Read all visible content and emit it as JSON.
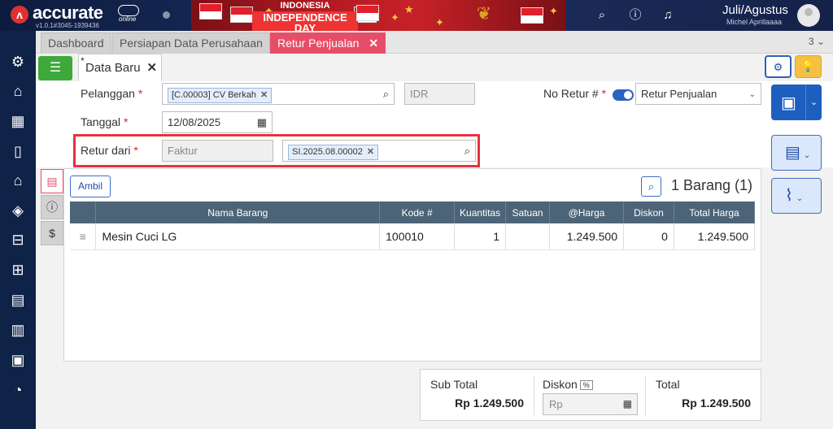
{
  "app": {
    "logo_text": "accurate",
    "logo_sub": "online",
    "version": "v1.0.1#3045-1939436",
    "banner_line1": "INDONESIA",
    "banner_line2": "INDEPENDENCE DAY",
    "user_name": "Juli/Agustus",
    "user_sub": "Michel Aprillaaaa"
  },
  "tabs": [
    {
      "label": "Dashboard"
    },
    {
      "label": "Persiapan Data Perusahaan"
    },
    {
      "label": "Retur Penjualan",
      "close": "✕"
    }
  ],
  "tab_count": "3",
  "doc_tab": {
    "label": "Data Baru",
    "asterisk": "*",
    "close": "✕"
  },
  "form": {
    "pelanggan_label": "Pelanggan",
    "pelanggan_value": "[C.00003] CV Berkah",
    "currency": "IDR",
    "no_retur_label": "No Retur #",
    "no_retur_type": "Retur Penjualan",
    "tanggal_label": "Tanggal",
    "tanggal_value": "12/08/2025",
    "retur_dari_label": "Retur dari",
    "retur_dari_type": "Faktur",
    "retur_dari_value": "SI.2025.08.00002",
    "required_mark": "*"
  },
  "detail": {
    "ambil_label": "Ambil",
    "count_label": "1 Barang (1)",
    "columns": [
      "Nama Barang",
      "Kode #",
      "Kuantitas",
      "Satuan",
      "@Harga",
      "Diskon",
      "Total Harga"
    ],
    "rows": [
      {
        "nama": "Mesin Cuci LG",
        "kode": "100010",
        "qty": "1",
        "satuan": "",
        "harga": "1.249.500",
        "diskon": "0",
        "total": "1.249.500"
      }
    ]
  },
  "totals": {
    "subtotal_label": "Sub Total",
    "subtotal_value": "Rp 1.249.500",
    "diskon_label": "Diskon",
    "diskon_pct": "%",
    "diskon_placeholder": "Rp",
    "total_label": "Total",
    "total_value": "Rp 1.249.500"
  },
  "colors": {
    "accent_tab": "#e84d68",
    "primary": "#1d5fbf",
    "green": "#3fa83a",
    "highlight_border": "#e8333f",
    "sidebar": "#0f2247"
  },
  "icons": {
    "sidebar": [
      "settings-icon",
      "shop-icon",
      "building-icon",
      "mobile-icon",
      "bank-icon",
      "tag-icon",
      "cart-icon",
      "truck-cart-icon",
      "warehouse-icon",
      "factory-icon",
      "tax-icon",
      "chart-icon"
    ],
    "top": [
      "search-icon",
      "help-icon",
      "bell-icon"
    ]
  }
}
